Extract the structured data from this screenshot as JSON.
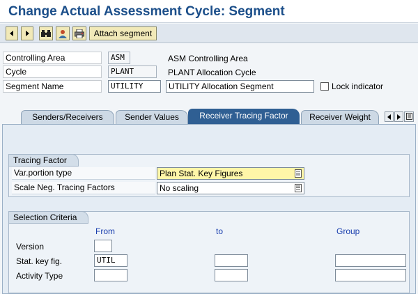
{
  "window": {
    "title": "Change Actual Assessment Cycle: Segment"
  },
  "toolbar": {
    "buttons": [
      {
        "icon": "arrow-left-icon"
      },
      {
        "icon": "arrow-right-icon"
      },
      {
        "icon": "binoculars-icon"
      },
      {
        "icon": "person-icon"
      },
      {
        "icon": "print-icon"
      }
    ],
    "attach_label": "Attach segment"
  },
  "header": {
    "controlling_area": {
      "label": "Controlling Area",
      "value": "ASM",
      "description": "ASM Controlling Area"
    },
    "cycle": {
      "label": "Cycle",
      "value": "PLANT",
      "description": "PLANT Allocation Cycle"
    },
    "segment_name": {
      "label": "Segment Name",
      "value": "UTILITY",
      "description": "UTILITY Allocation Segment"
    },
    "lock_indicator": {
      "label": "Lock indicator",
      "checked": false
    }
  },
  "tabs": [
    {
      "label": "Senders/Receivers",
      "active": false
    },
    {
      "label": "Sender Values",
      "active": false
    },
    {
      "label": "Receiver Tracing Factor",
      "active": true
    },
    {
      "label": "Receiver Weight",
      "active": false
    }
  ],
  "tracing_factor": {
    "title": "Tracing Factor",
    "var_portion_type": {
      "label": "Var.portion type",
      "value": "Plan Stat. Key Figures"
    },
    "scale_neg": {
      "label": "Scale Neg. Tracing Factors",
      "value": "No scaling"
    }
  },
  "selection_criteria": {
    "title": "Selection Criteria",
    "columns": {
      "from": "From",
      "to": "to",
      "group": "Group"
    },
    "rows": [
      {
        "label": "Version",
        "from": "",
        "to": null,
        "group": null
      },
      {
        "label": "Stat. key fig.",
        "from": "UTIL",
        "to": "",
        "group": ""
      },
      {
        "label": "Activity Type",
        "from": "",
        "to": "",
        "group": ""
      }
    ]
  },
  "colors": {
    "title": "#1c4f8a",
    "active_tab": "#2f5f93",
    "highlight_field": "#fff6a8",
    "column_header": "#1a3fae",
    "button_bg": "#f1e9b8"
  }
}
